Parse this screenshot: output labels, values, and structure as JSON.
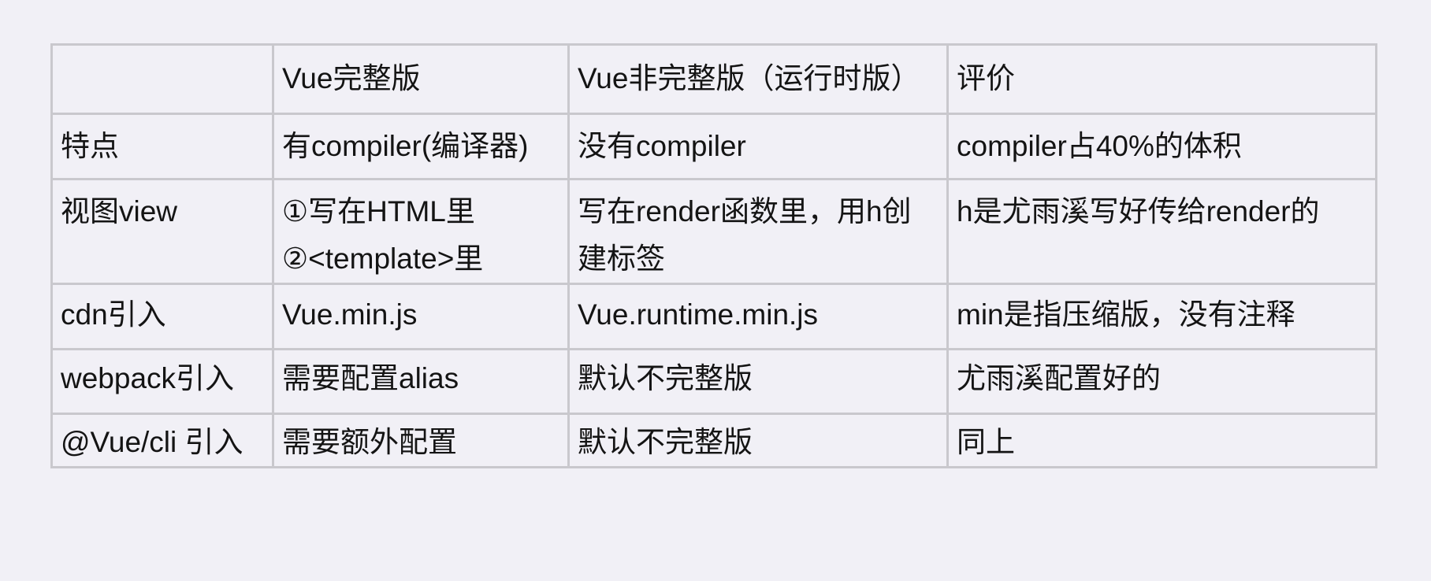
{
  "table": {
    "header": [
      "",
      "Vue完整版",
      "Vue非完整版（运行时版）",
      "评价"
    ],
    "rows": [
      {
        "label": "特点",
        "full": [
          "有compiler(编译器)"
        ],
        "runtime": [
          "没有compiler"
        ],
        "comment": [
          "compiler占40%的体积"
        ]
      },
      {
        "label": "视图view",
        "full": [
          "①写在HTML里",
          "②<template>里"
        ],
        "runtime": [
          "写在render函数里，用h创建标签"
        ],
        "comment": [
          "h是尤雨溪写好传给render的"
        ]
      },
      {
        "label": "cdn引入",
        "full": [
          "Vue.min.js"
        ],
        "runtime": [
          "Vue.runtime.min.js"
        ],
        "comment": [
          "min是指压缩版，没有注释"
        ]
      },
      {
        "label": "webpack引入",
        "full": [
          "需要配置alias"
        ],
        "runtime": [
          "默认不完整版"
        ],
        "comment": [
          "尤雨溪配置好的"
        ]
      },
      {
        "label": "@Vue/cli 引入",
        "full": [
          "需要额外配置"
        ],
        "runtime": [
          "默认不完整版"
        ],
        "comment": [
          "同上"
        ]
      }
    ]
  }
}
